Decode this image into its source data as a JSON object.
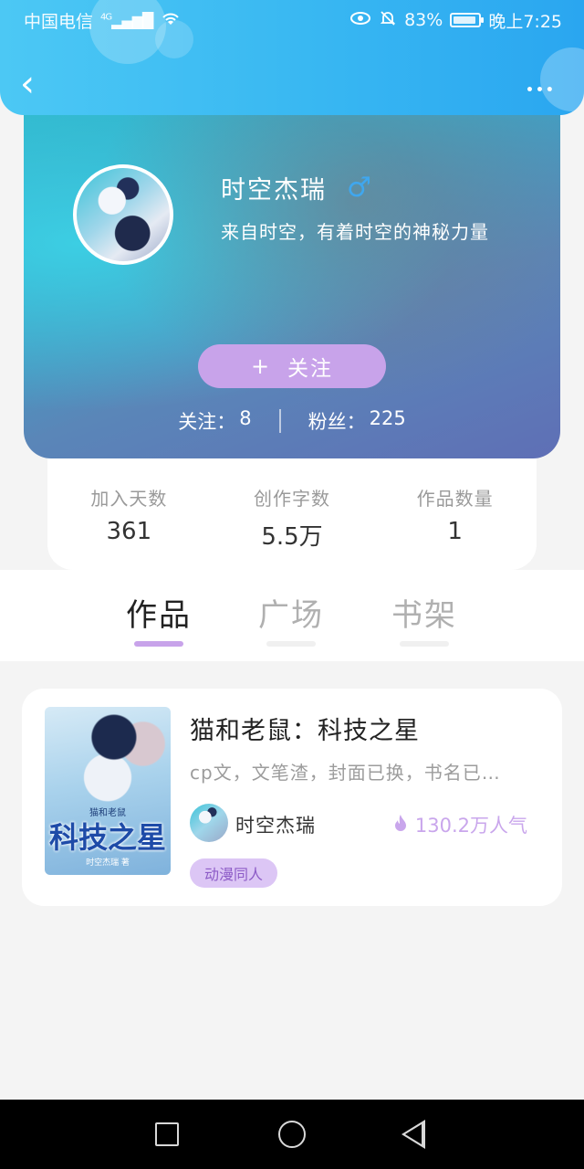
{
  "status_bar": {
    "carrier": "中国电信",
    "network": "4G",
    "battery_percent": "83%",
    "time": "晚上7:25",
    "icons": [
      "signal-icon",
      "wifi-icon",
      "eye-icon",
      "bell-off-icon",
      "battery-icon"
    ]
  },
  "header": {
    "back_icon": "chevron-left-icon",
    "more_icon": "more-dots-icon",
    "back_glyph": "‹",
    "more_glyph": "•••"
  },
  "profile": {
    "nickname": "时空杰瑞",
    "gender_icon": "male-icon",
    "gender_glyph": "♂",
    "bio": "来自时空，有着时空的神秘力量",
    "follow_plus": "+",
    "follow_label": "关注",
    "following_label": "关注：",
    "following_count": "8",
    "fans_label": "粉丝：",
    "fans_count": "225"
  },
  "stats": [
    {
      "label": "加入天数",
      "value": "361"
    },
    {
      "label": "创作字数",
      "value": "5.5万"
    },
    {
      "label": "作品数量",
      "value": "1"
    }
  ],
  "tabs": [
    {
      "label": "作品",
      "active": true
    },
    {
      "label": "广场",
      "active": false
    },
    {
      "label": "书架",
      "active": false
    }
  ],
  "works": [
    {
      "title": "猫和老鼠：科技之星",
      "description": "cp文，文笔渣，封面已换，书名已…",
      "author": "时空杰瑞",
      "popularity": "130.2万人气",
      "flame_icon": "flame-icon",
      "flame_glyph": "🔥",
      "tag": "动漫同人",
      "cover": {
        "title": "科技之星",
        "subtitle": "猫和老鼠",
        "author_line": "时空杰瑞 著"
      }
    }
  ],
  "nav_bar": {
    "icons": [
      "recent-apps-icon",
      "home-icon",
      "back-triangle-icon"
    ]
  },
  "colors": {
    "header_gradient_start": "#4cc8f4",
    "header_gradient_end": "#2aa6f0",
    "accent_purple": "#c8a3ea",
    "gender_blue": "#3fa7ef"
  }
}
